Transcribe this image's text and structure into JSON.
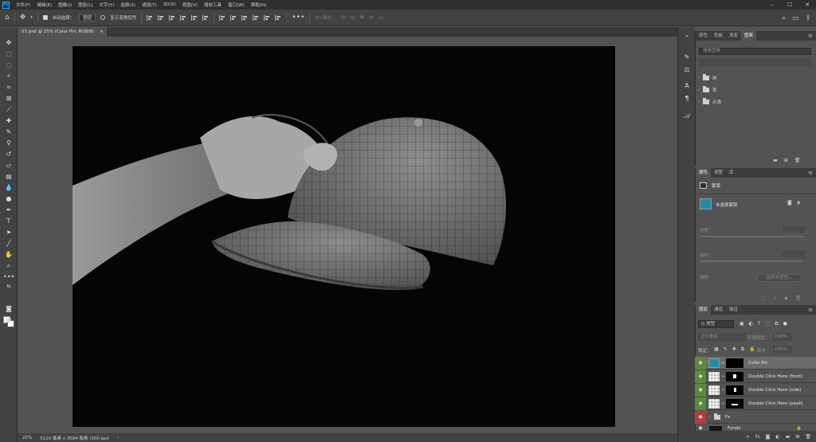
{
  "app": {
    "logo": "Ps"
  },
  "menu": [
    "文件(F)",
    "编辑(E)",
    "图像(I)",
    "图层(L)",
    "文字(Y)",
    "选择(S)",
    "滤镜(T)",
    "3D(D)",
    "视图(V)",
    "增效工具",
    "窗口(W)",
    "帮助(H)"
  ],
  "options": {
    "auto_select_label": "自动选择：",
    "auto_select_value": "图层",
    "transform_label": "显示变换控件",
    "mode_3d": "3D 模式："
  },
  "document": {
    "tab_title": "01.psd @ 25% (Color Pin, RGB/8)",
    "close": "×"
  },
  "status": {
    "zoom": "25%",
    "size": "5120 像素 x 3584 像素 (300 ppi)",
    "arrow": "›"
  },
  "libraries_panel": {
    "tabs": [
      "颜色",
      "色板",
      "渐变",
      "图案"
    ],
    "active_tab": "图案",
    "search_placeholder": "搜索图案",
    "folders": [
      "树",
      "草",
      "水滴"
    ]
  },
  "properties_panel": {
    "tabs": [
      "属性",
      "调整",
      "库"
    ],
    "active_tab": "属性",
    "section": "蒙版",
    "mask_state": "未选择蒙版",
    "density_label": "浓度：",
    "feather_label": "羽化：",
    "adjust_label": "调整：",
    "select_edge_button": "选择并遮住..."
  },
  "layers_panel": {
    "tabs": [
      "图层",
      "通道",
      "路径"
    ],
    "active_tab": "图层",
    "filter_kind": "Q 类型",
    "blend_mode": "正片叠底",
    "opacity_label": "不透明度：",
    "opacity_value": "100%",
    "lock_label": "锁定：",
    "fill_label": "填充：",
    "fill_value": "100%",
    "layers": [
      {
        "name": "Color Pin",
        "type": "color",
        "selected": true
      },
      {
        "name": "Double Click Here (front)",
        "type": "smart"
      },
      {
        "name": "Double Click Here (side)",
        "type": "smart"
      },
      {
        "name": "Double Click Here (peak)",
        "type": "smart"
      },
      {
        "name": "Fx",
        "type": "group"
      },
      {
        "name": "Fondo",
        "type": "photo"
      }
    ]
  },
  "colors": {
    "eye_green": "#5a8a3a",
    "eye_red": "#b83a3a",
    "selected_layer": "#6b6b6b",
    "accent_blue": "#31a8ff"
  }
}
